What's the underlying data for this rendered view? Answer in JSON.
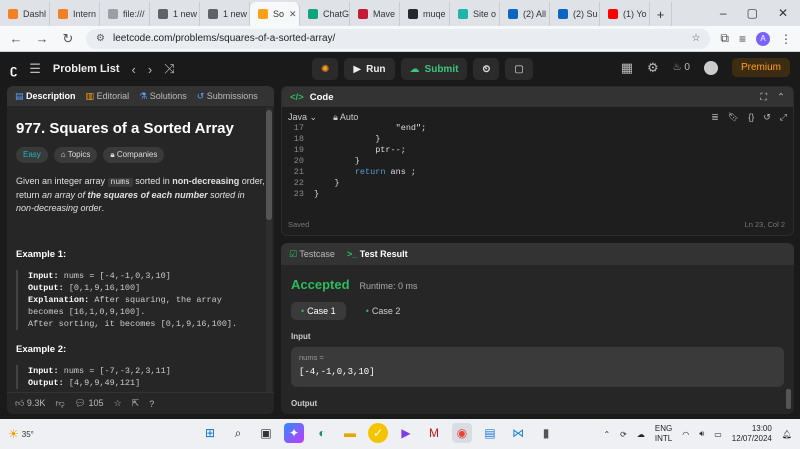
{
  "browser": {
    "tabs": [
      {
        "label": "Dashl",
        "color": "#f48024"
      },
      {
        "label": "Intern",
        "color": "#f48024"
      },
      {
        "label": "file:///",
        "color": "#9aa0a6"
      },
      {
        "label": "1 new",
        "color": "#5f6368"
      },
      {
        "label": "1 new",
        "color": "#5f6368"
      },
      {
        "label": "So",
        "color": "#ffa116",
        "active": true
      },
      {
        "label": "ChatG",
        "color": "#10a37f"
      },
      {
        "label": "Mave",
        "color": "#c71a36"
      },
      {
        "label": "muqe",
        "color": "#24292f"
      },
      {
        "label": "Site o",
        "color": "#1eb5a7"
      },
      {
        "label": "(2) All",
        "color": "#0a66c2"
      },
      {
        "label": "(2) Su",
        "color": "#0a66c2"
      },
      {
        "label": "(1) Yo",
        "color": "#ff0000"
      }
    ],
    "new_tab": "+",
    "window_controls": [
      "–",
      "▢",
      "✕"
    ],
    "url": "leetcode.com/problems/squares-of-a-sorted-array/",
    "profile_initial": "A"
  },
  "lc_top": {
    "problem_list": "Problem List",
    "run": "Run",
    "submit": "Submit",
    "streak": "0",
    "premium": "Premium"
  },
  "left": {
    "tabs": [
      "Description",
      "Editorial",
      "Solutions",
      "Submissions"
    ],
    "title": "977. Squares of a Sorted Array",
    "chips": [
      "Easy",
      "Topics",
      "Companies"
    ],
    "desc": {
      "p1": "Given an integer array ",
      "code": "nums",
      "p2": " sorted in ",
      "b1": "non-decreasing",
      "p3": " order, return ",
      "i1": "an array of ",
      "ib": "the squares of each number",
      "i2": " sorted in non-decreasing order",
      "p4": "."
    },
    "example1": {
      "heading": "Example 1:",
      "input_label": "Input:",
      "input": "nums = [-4,-1,0,3,10]",
      "output_label": "Output:",
      "output": "[0,1,9,16,100]",
      "expl_label": "Explanation:",
      "expl1": "After squaring, the array",
      "expl2": "becomes [16,1,0,9,100].",
      "expl3": "After sorting, it becomes [0,1,9,16,100]."
    },
    "example2": {
      "heading": "Example 2:",
      "input_label": "Input:",
      "input": "nums = [-7,-3,2,3,11]",
      "output_label": "Output:",
      "output": "[4,9,9,49,121]"
    },
    "bottom": {
      "likes": "9.3K",
      "comments": "105"
    }
  },
  "code": {
    "header": "Code",
    "language": "Java",
    "mode": "Auto",
    "lines": [
      {
        "n": "17",
        "t": "                \"end\";"
      },
      {
        "n": "18",
        "t": "            }"
      },
      {
        "n": "19",
        "t": "            ptr--;"
      },
      {
        "n": "20",
        "t": "        }"
      },
      {
        "n": "21",
        "t": "        return ans ;"
      },
      {
        "n": "22",
        "t": "    }"
      },
      {
        "n": "23",
        "t": "}"
      }
    ],
    "status": "Saved",
    "cursor": "Ln 23, Col 2"
  },
  "test": {
    "tabs": [
      "Testcase",
      "Test Result"
    ],
    "result": "Accepted",
    "runtime": "Runtime: 0 ms",
    "cases": [
      "Case 1",
      "Case 2"
    ],
    "input_label": "Input",
    "input_name": "nums =",
    "input_value": "[-4,-1,0,3,10]",
    "output_label": "Output"
  },
  "taskbar": {
    "temp": "35°",
    "lang_line1": "ENG",
    "lang_line2": "INTL",
    "time": "13:00",
    "date": "12/07/2024"
  }
}
